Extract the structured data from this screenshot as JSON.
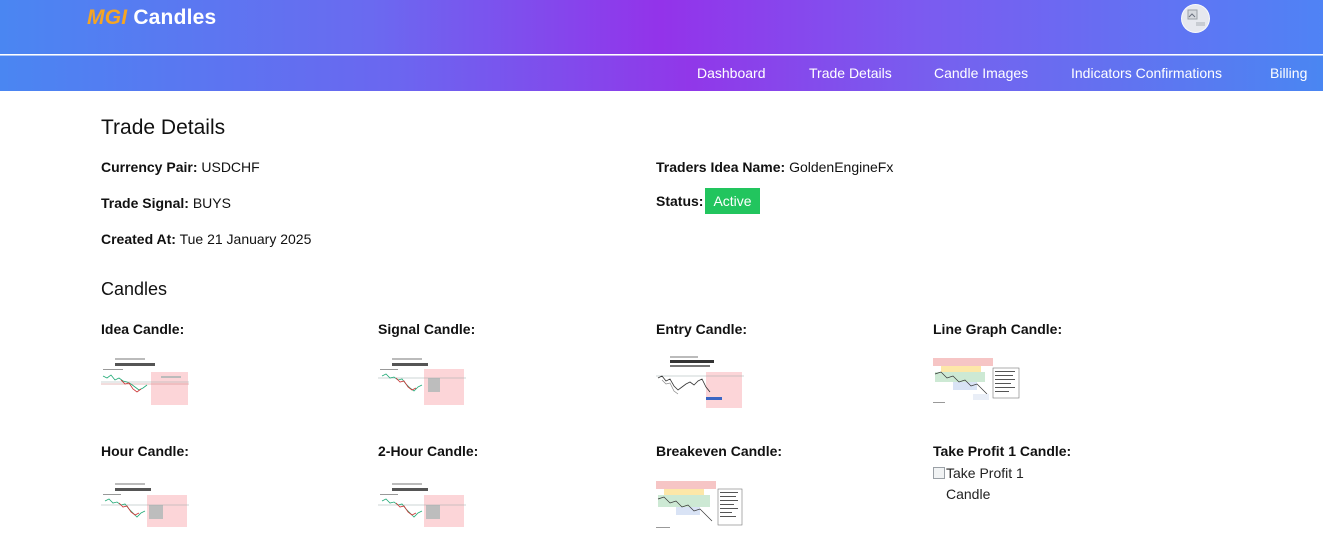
{
  "brand": {
    "prefix": "MGI",
    "name": "Candles"
  },
  "nav": {
    "items": [
      {
        "label": "Dashboard"
      },
      {
        "label": "Trade Details"
      },
      {
        "label": "Candle Images"
      },
      {
        "label": "Indicators Confirmations"
      },
      {
        "label": "Billing"
      }
    ]
  },
  "page": {
    "title": "Trade Details",
    "fields": {
      "currency_pair": {
        "label": "Currency Pair:",
        "value": "USDCHF"
      },
      "traders_idea": {
        "label": "Traders Idea Name:",
        "value": "GoldenEngineFx"
      },
      "trade_signal": {
        "label": "Trade Signal:",
        "value": "BUYS"
      },
      "status": {
        "label": "Status:",
        "value": "Active"
      },
      "created_at": {
        "label": "Created At:",
        "value": "Tue 21 January 2025"
      }
    }
  },
  "candles": {
    "title": "Candles",
    "items": [
      {
        "label": "Idea Candle:"
      },
      {
        "label": "Signal Candle:"
      },
      {
        "label": "Entry Candle:"
      },
      {
        "label": "Line Graph Candle:"
      },
      {
        "label": "Hour Candle:"
      },
      {
        "label": "2-Hour Candle:"
      },
      {
        "label": "Breakeven Candle:"
      },
      {
        "label": "Take Profit 1 Candle:",
        "alt": "Take Profit 1 Candle"
      }
    ]
  },
  "colors": {
    "status_active": "#22c55e",
    "brand_accent": "#f5a524"
  }
}
